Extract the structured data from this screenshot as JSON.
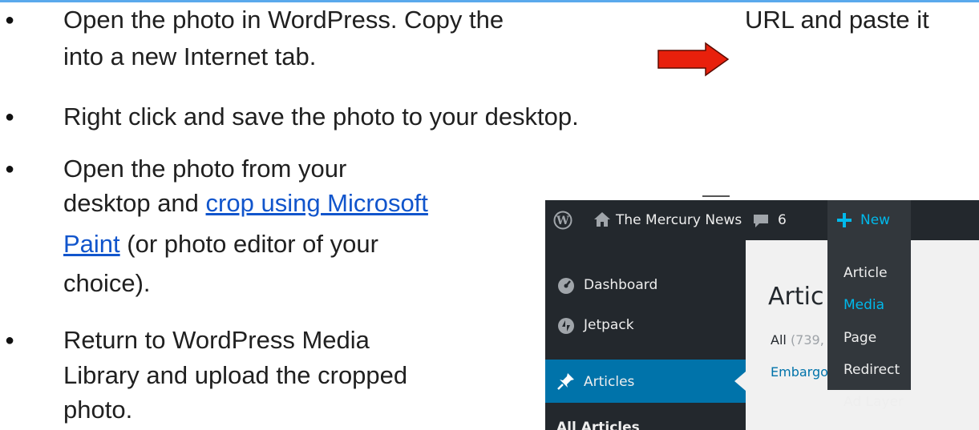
{
  "bullets": [
    {
      "line1_part1": "Open the photo in WordPress. Copy the",
      "line1_part2": "URL and paste it",
      "line2": "into a new Internet tab."
    },
    {
      "text": "Right click and save the photo to your desktop."
    },
    {
      "line1": "Open the photo from your",
      "line2_prefix": "desktop and ",
      "link_part1": "crop using Microsoft",
      "link_part2": "Paint",
      "line3_suffix": " (or photo editor of your",
      "line4": "choice)."
    },
    {
      "line1": "Return to WordPress Media",
      "line2": "Library and upload the cropped",
      "line3": "photo."
    }
  ],
  "bullet_symbol": "●",
  "colors": {
    "arrow_fill": "#e8200c",
    "link": "#1155cc",
    "wp_admin_bar": "#23282d",
    "wp_active": "#0073aa",
    "wp_highlight": "#00b9eb"
  },
  "wordpress": {
    "site_name": "The Mercury News",
    "comments_count": "6",
    "new_label": "New",
    "new_menu": [
      "Article",
      "Media",
      "Page",
      "Redirect",
      "Ad Layer"
    ],
    "new_menu_highlighted": "Media",
    "sidebar": [
      "Dashboard",
      "Jetpack",
      "Articles",
      "All Articles"
    ],
    "sidebar_icons": [
      "wordpress-logo-icon",
      "home-icon",
      "comment-icon",
      "plus-icon",
      "dashboard-icon",
      "jetpack-icon",
      "pin-icon"
    ],
    "page_title": "Artic",
    "filter_all": "All",
    "filter_count": "(739,",
    "filter_embargo": "Embargo"
  }
}
